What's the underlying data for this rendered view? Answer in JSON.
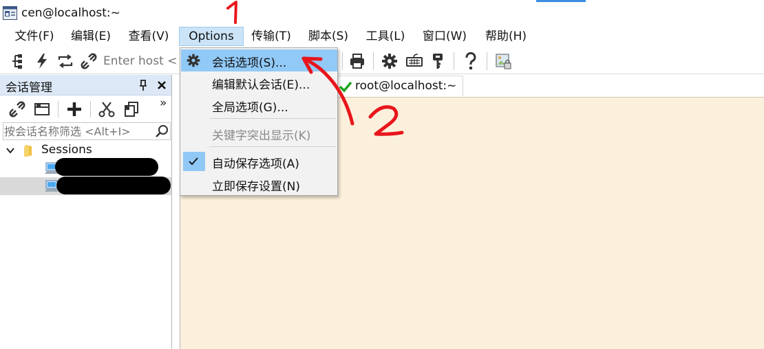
{
  "window": {
    "title": "cen@localhost:~"
  },
  "menubar": {
    "items": [
      {
        "label": "文件(F)"
      },
      {
        "label": "编辑(E)"
      },
      {
        "label": "查看(V)"
      },
      {
        "label": "Options"
      },
      {
        "label": "传输(T)"
      },
      {
        "label": "脚本(S)"
      },
      {
        "label": "工具(L)"
      },
      {
        "label": "窗口(W)"
      },
      {
        "label": "帮助(H)"
      }
    ]
  },
  "toolbar": {
    "host_placeholder": "Enter host <Alt+R>"
  },
  "session_panel": {
    "title": "会话管理",
    "search_placeholder": "按会话名称筛选 <Alt+I>",
    "more_label": "»",
    "tree": {
      "root_label": "Sessions"
    }
  },
  "options_menu": {
    "items": [
      {
        "label": "会话选项(S)...",
        "icon": "gear-icon",
        "state": "highlighted"
      },
      {
        "label": "编辑默认会话(E)...",
        "state": "normal"
      },
      {
        "label": "全局选项(G)...",
        "state": "normal"
      },
      {
        "label": "关键字突出显示(K)",
        "state": "disabled"
      },
      {
        "label": "自动保存选项(A)",
        "state": "checked"
      },
      {
        "label": "立即保存设置(N)",
        "state": "normal"
      }
    ]
  },
  "tab": {
    "label": "root@localhost:~",
    "status_icon": "check-icon"
  },
  "annotations": {
    "mark_1": "1",
    "mark_2": "2",
    "color": "#e8161c"
  },
  "colors": {
    "terminal_bg": "#fbf0dc",
    "menu_highlight": "#91c9f7",
    "panel_header": "#dce8f5"
  }
}
